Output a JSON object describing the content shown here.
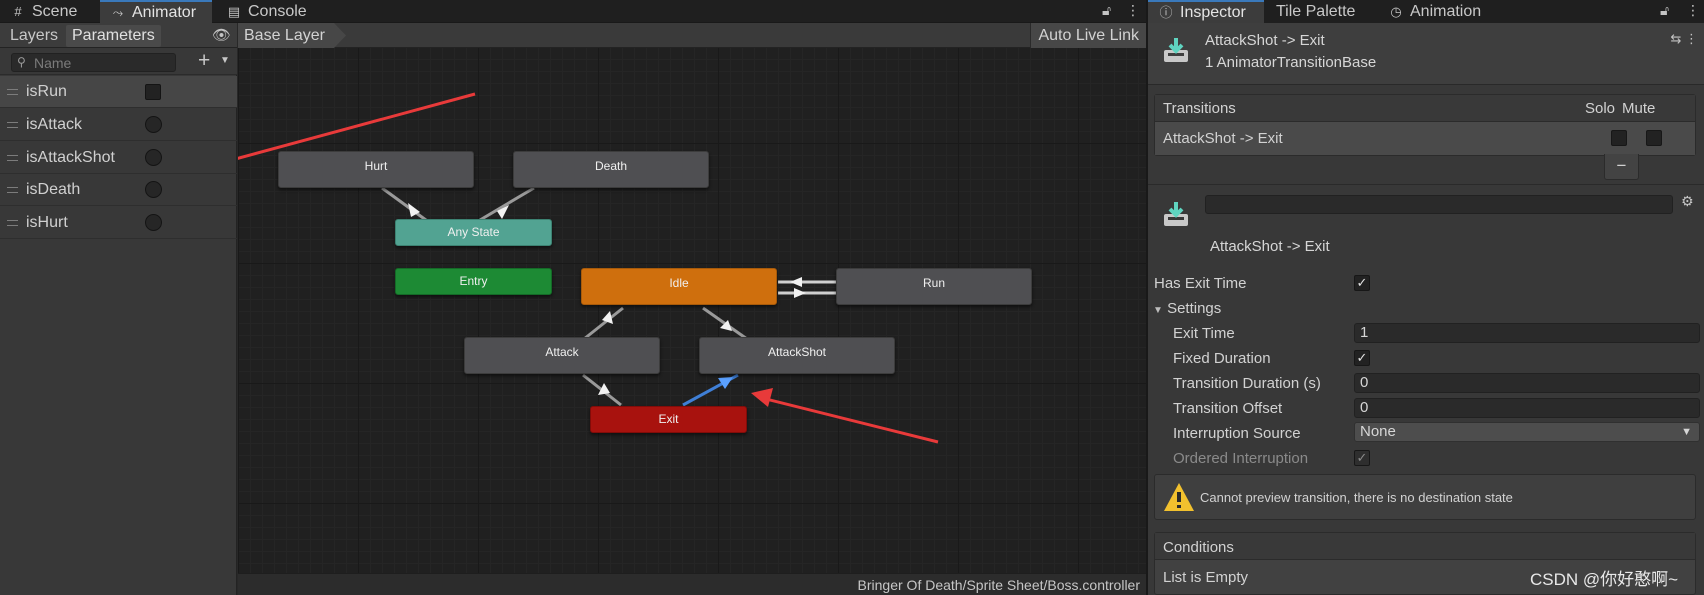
{
  "left_window": {
    "tabs": [
      {
        "label": "Scene",
        "icon": "grid-icon"
      },
      {
        "label": "Animator",
        "icon": "animator-icon"
      },
      {
        "label": "Console",
        "icon": "console-icon"
      }
    ],
    "active_tab": "Animator"
  },
  "params_panel": {
    "tabs": [
      "Layers",
      "Parameters"
    ],
    "active_tab": "Parameters",
    "search_placeholder": "Name",
    "parameters": [
      {
        "name": "isRun",
        "type": "trigger"
      },
      {
        "name": "isAttack",
        "type": "bool"
      },
      {
        "name": "isAttackShot",
        "type": "bool"
      },
      {
        "name": "isDeath",
        "type": "bool"
      },
      {
        "name": "isHurt",
        "type": "bool"
      }
    ]
  },
  "graph": {
    "breadcrumb": "Base Layer",
    "auto_live_link": "Auto Live Link",
    "status_path": "Bringer Of Death/Sprite Sheet/Boss.controller",
    "states": {
      "hurt": "Hurt",
      "death": "Death",
      "any_state": "Any State",
      "entry": "Entry",
      "idle": "Idle",
      "run": "Run",
      "attack": "Attack",
      "attackshot": "AttackShot",
      "exit": "Exit"
    },
    "colors": {
      "default_state": "#4f4f52",
      "any_state": "#52a392",
      "entry": "#1d8a34",
      "default": "#cf6f0d",
      "exit": "#a8120e",
      "selected_transition": "#3f7fd6",
      "annotation_arrow": "#e83a3a"
    }
  },
  "right_window": {
    "tabs": [
      {
        "label": "Inspector",
        "icon": "info-icon"
      },
      {
        "label": "Tile Palette",
        "icon": ""
      },
      {
        "label": "Animation",
        "icon": "clock-icon"
      }
    ],
    "active_tab": "Inspector"
  },
  "inspector": {
    "title": "AttackShot -> Exit",
    "subtitle": "1 AnimatorTransitionBase",
    "transitions_header": "Transitions",
    "solo_label": "Solo",
    "mute_label": "Mute",
    "transition_row": "AttackShot -> Exit",
    "transition_name": "AttackShot -> Exit",
    "has_exit_time_label": "Has Exit Time",
    "has_exit_time": true,
    "settings_label": "Settings",
    "exit_time_label": "Exit Time",
    "exit_time": "1",
    "fixed_duration_label": "Fixed Duration",
    "fixed_duration": true,
    "transition_duration_label": "Transition Duration (s)",
    "transition_duration": "0",
    "transition_offset_label": "Transition Offset",
    "transition_offset": "0",
    "interruption_source_label": "Interruption Source",
    "interruption_source": "None",
    "ordered_interruption_label": "Ordered Interruption",
    "warning": "Cannot preview transition, there is no destination state",
    "conditions_header": "Conditions",
    "conditions_empty": "List is Empty"
  },
  "watermark": "CSDN @你好憨啊~"
}
